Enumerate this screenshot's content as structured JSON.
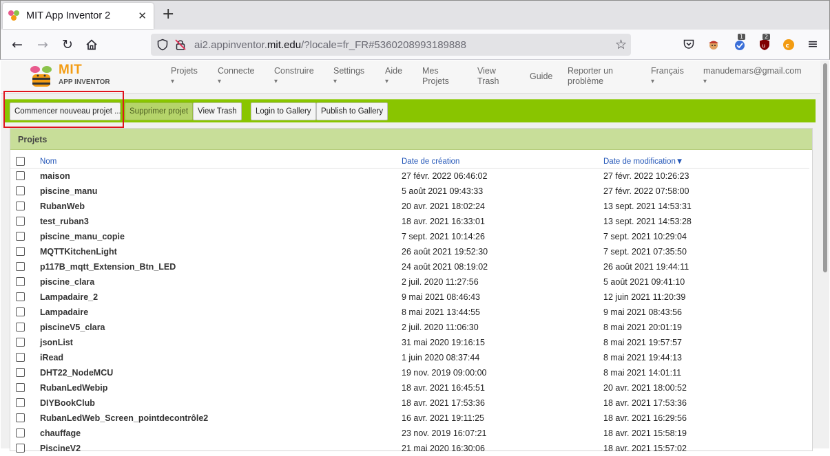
{
  "browser": {
    "tab_title": "MIT App Inventor 2",
    "url_prefix": "ai2.appinventor.",
    "url_domain": "mit.edu",
    "url_suffix": "/?locale=fr_FR#5360208993189888",
    "badge_1": "1",
    "badge_2": "2"
  },
  "app": {
    "logo_mit": "MIT",
    "logo_sub": "APP INVENTOR",
    "menu": [
      {
        "label": "Projets",
        "caret": "▾"
      },
      {
        "label": "Connecte",
        "caret": "▾"
      },
      {
        "label": "Construire",
        "caret": "▾"
      },
      {
        "label": "Settings",
        "caret": "▾"
      },
      {
        "label": "Aide",
        "caret": "▾"
      },
      {
        "label": "Mes\nProjets",
        "caret": ""
      },
      {
        "label": "View\nTrash",
        "caret": ""
      },
      {
        "label": "Guide",
        "caret": ""
      },
      {
        "label": "Reporter un\nproblème",
        "caret": ""
      },
      {
        "label": "Français",
        "caret": "▾"
      },
      {
        "label": "manudemars@gmail.com",
        "caret": "▾"
      }
    ],
    "toolbar": {
      "new_project": "Commencer nouveau projet ...",
      "delete_project": "Supprimer projet",
      "view_trash": "View Trash",
      "login_gallery": "Login to Gallery",
      "publish_gallery": "Publish to Gallery"
    },
    "panel_title": "Projets",
    "columns": {
      "name": "Nom",
      "created": "Date de création",
      "modified": "Date de modification▼"
    },
    "projects": [
      {
        "name": "maison",
        "created": "27 févr. 2022 06:46:02",
        "modified": "27 févr. 2022 10:26:23"
      },
      {
        "name": "piscine_manu",
        "created": "5 août 2021 09:43:33",
        "modified": "27 févr. 2022 07:58:00"
      },
      {
        "name": "RubanWeb",
        "created": "20 avr. 2021 18:02:24",
        "modified": "13 sept. 2021 14:53:31"
      },
      {
        "name": "test_ruban3",
        "created": "18 avr. 2021 16:33:01",
        "modified": "13 sept. 2021 14:53:28"
      },
      {
        "name": "piscine_manu_copie",
        "created": "7 sept. 2021 10:14:26",
        "modified": "7 sept. 2021 10:29:04"
      },
      {
        "name": "MQTTKitchenLight",
        "created": "26 août 2021 19:52:30",
        "modified": "7 sept. 2021 07:35:50"
      },
      {
        "name": "p117B_mqtt_Extension_Btn_LED",
        "created": "24 août 2021 08:19:02",
        "modified": "26 août 2021 19:44:11"
      },
      {
        "name": "piscine_clara",
        "created": "2 juil. 2020 11:27:56",
        "modified": "5 août 2021 09:41:10"
      },
      {
        "name": "Lampadaire_2",
        "created": "9 mai 2021 08:46:43",
        "modified": "12 juin 2021 11:20:39"
      },
      {
        "name": "Lampadaire",
        "created": "8 mai 2021 13:44:55",
        "modified": "9 mai 2021 08:43:56"
      },
      {
        "name": "piscineV5_clara",
        "created": "2 juil. 2020 11:06:30",
        "modified": "8 mai 2021 20:01:19"
      },
      {
        "name": "jsonList",
        "created": "31 mai 2020 19:16:15",
        "modified": "8 mai 2021 19:57:57"
      },
      {
        "name": "iRead",
        "created": "1 juin 2020 08:37:44",
        "modified": "8 mai 2021 19:44:13"
      },
      {
        "name": "DHT22_NodeMCU",
        "created": "19 nov. 2019 09:00:00",
        "modified": "8 mai 2021 14:01:11"
      },
      {
        "name": "RubanLedWebip",
        "created": "18 avr. 2021 16:45:51",
        "modified": "20 avr. 2021 18:00:52"
      },
      {
        "name": "DIYBookClub",
        "created": "18 avr. 2021 17:53:36",
        "modified": "18 avr. 2021 17:53:36"
      },
      {
        "name": "RubanLedWeb_Screen_pointdecontrôle2",
        "created": "16 avr. 2021 19:11:25",
        "modified": "18 avr. 2021 16:29:56"
      },
      {
        "name": "chauffage",
        "created": "23 nov. 2019 16:07:21",
        "modified": "18 avr. 2021 15:58:19"
      },
      {
        "name": "PiscineV2",
        "created": "21 mai 2020 16:30:06",
        "modified": "18 avr. 2021 15:57:02"
      }
    ]
  },
  "colors": {
    "toolbar_green": "#89c500",
    "panel_header": "#c8de99",
    "highlight_red": "#e0141e",
    "logo_orange": "#f39c12"
  }
}
